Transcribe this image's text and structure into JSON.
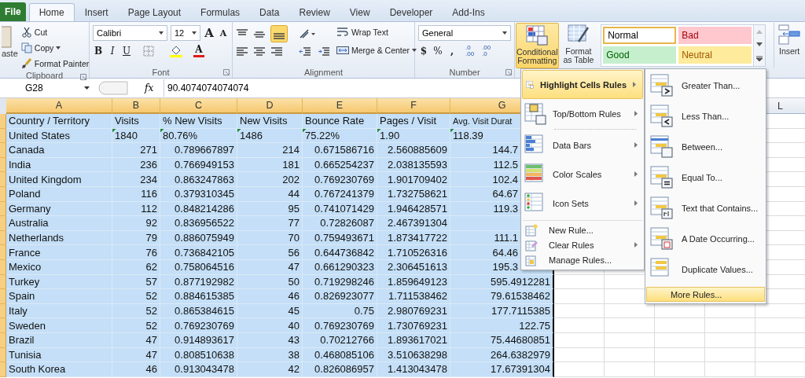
{
  "tabs": [
    {
      "label": "File",
      "kind": "file",
      "selected": false
    },
    {
      "label": "Home",
      "kind": "tab",
      "selected": true
    },
    {
      "label": "Insert",
      "kind": "tab",
      "selected": false
    },
    {
      "label": "Page Layout",
      "kind": "tab",
      "selected": false
    },
    {
      "label": "Formulas",
      "kind": "tab",
      "selected": false
    },
    {
      "label": "Data",
      "kind": "tab",
      "selected": false
    },
    {
      "label": "Review",
      "kind": "tab",
      "selected": false
    },
    {
      "label": "View",
      "kind": "tab",
      "selected": false
    },
    {
      "label": "Developer",
      "kind": "tab",
      "selected": false
    },
    {
      "label": "Add-Ins",
      "kind": "tab",
      "selected": false
    }
  ],
  "ribbon": {
    "clipboard": {
      "paste": "aste",
      "cut": "Cut",
      "copy": "Copy",
      "format_painter": "Format Painter",
      "label": "Clipboard"
    },
    "font": {
      "name": "Calibri",
      "size": "12",
      "grow": "A",
      "shrink": "A",
      "bold": "B",
      "italic": "I",
      "underline": "U",
      "font_color": "A",
      "label": "Font"
    },
    "alignment": {
      "wrap_text": "Wrap Text",
      "merge_center": "Merge & Center",
      "label": "Alignment"
    },
    "number": {
      "format": "General",
      "currency": "$",
      "percent": "%",
      "comma": ",",
      "increase_decimal": [
        ".0",
        ".00"
      ],
      "decrease_decimal": [
        ".00",
        ".0"
      ],
      "label": "Number"
    },
    "conditional_formatting": {
      "line1": "Conditional",
      "line2": "Formatting",
      "selected": true
    },
    "format_as_table": {
      "line1": "Format",
      "line2": "as Table"
    },
    "styles": [
      {
        "label": "Normal",
        "kind": "normal",
        "selected": true
      },
      {
        "label": "Bad",
        "kind": "bad",
        "selected": false
      },
      {
        "label": "Good",
        "kind": "good",
        "selected": false
      },
      {
        "label": "Neutral",
        "kind": "neutral",
        "selected": false
      }
    ],
    "insert": "Insert"
  },
  "formula_bar": {
    "name_box": "G28",
    "fx": "fx",
    "formula": "90.4074074074074"
  },
  "table": {
    "columns": [
      "A",
      "B",
      "C",
      "D",
      "E",
      "F",
      "G",
      "L"
    ],
    "header": [
      "Country / Territory",
      "Visits",
      "% New Visits",
      "New Visits",
      "Bounce Rate",
      "Pages / Visit",
      "Avg. Visit Durat"
    ],
    "rows": [
      {
        "flagged": true,
        "cells": [
          "United States",
          "1840",
          "80.76%",
          "1486",
          "75.22%",
          "1.90",
          "118.39"
        ]
      },
      {
        "flagged": false,
        "cells": [
          "Canada",
          "271",
          "0.789667897",
          "214",
          "0.671586716",
          "2.560885609",
          "144.7"
        ]
      },
      {
        "flagged": false,
        "cells": [
          "India",
          "236",
          "0.766949153",
          "181",
          "0.665254237",
          "2.038135593",
          "112.5"
        ]
      },
      {
        "flagged": false,
        "cells": [
          "United Kingdom",
          "234",
          "0.863247863",
          "202",
          "0.769230769",
          "1.901709402",
          "102.4"
        ]
      },
      {
        "flagged": false,
        "cells": [
          "Poland",
          "116",
          "0.379310345",
          "44",
          "0.767241379",
          "1.732758621",
          "64.67"
        ]
      },
      {
        "flagged": false,
        "cells": [
          "Germany",
          "112",
          "0.848214286",
          "95",
          "0.741071429",
          "1.946428571",
          "119.3"
        ]
      },
      {
        "flagged": false,
        "cells": [
          "Australia",
          "92",
          "0.836956522",
          "77",
          "0.72826087",
          "2.467391304"
        ]
      },
      {
        "flagged": false,
        "cells": [
          "Netherlands",
          "79",
          "0.886075949",
          "70",
          "0.759493671",
          "1.873417722",
          "111.1"
        ]
      },
      {
        "flagged": false,
        "cells": [
          "France",
          "76",
          "0.736842105",
          "56",
          "0.644736842",
          "1.710526316",
          "64.46"
        ]
      },
      {
        "flagged": false,
        "cells": [
          "Mexico",
          "62",
          "0.758064516",
          "47",
          "0.661290323",
          "2.306451613",
          "195.3"
        ]
      },
      {
        "flagged": false,
        "cells": [
          "Turkey",
          "57",
          "0.877192982",
          "50",
          "0.719298246",
          "1.859649123",
          "595.4912281"
        ]
      },
      {
        "flagged": false,
        "cells": [
          "Spain",
          "52",
          "0.884615385",
          "46",
          "0.826923077",
          "1.711538462",
          "79.61538462"
        ]
      },
      {
        "flagged": false,
        "cells": [
          "Italy",
          "52",
          "0.865384615",
          "45",
          "0.75",
          "2.980769231",
          "177.7115385"
        ]
      },
      {
        "flagged": false,
        "cells": [
          "Sweden",
          "52",
          "0.769230769",
          "40",
          "0.769230769",
          "1.730769231",
          "122.75"
        ]
      },
      {
        "flagged": false,
        "cells": [
          "Brazil",
          "47",
          "0.914893617",
          "43",
          "0.70212766",
          "1.893617021",
          "75.44680851"
        ]
      },
      {
        "flagged": false,
        "cells": [
          "Tunisia",
          "47",
          "0.808510638",
          "38",
          "0.468085106",
          "3.510638298",
          "264.6382979"
        ]
      },
      {
        "flagged": false,
        "cells": [
          "South Korea",
          "46",
          "0.913043478",
          "42",
          "0.826086957",
          "1.413043478",
          "17.67391304"
        ]
      }
    ]
  },
  "menu": {
    "items": [
      {
        "label": "Highlight Cells Rules",
        "kind": "large",
        "submenu": true,
        "selected": true
      },
      {
        "label": "Top/Bottom Rules",
        "kind": "large",
        "submenu": true,
        "selected": false
      },
      {
        "label": "Data Bars",
        "kind": "large",
        "submenu": true,
        "selected": false
      },
      {
        "label": "Color Scales",
        "kind": "large",
        "submenu": true,
        "selected": false
      },
      {
        "label": "Icon Sets",
        "kind": "large",
        "submenu": true,
        "selected": false
      },
      {
        "label": "New Rule...",
        "kind": "small",
        "submenu": false,
        "selected": false
      },
      {
        "label": "Clear Rules",
        "kind": "small",
        "submenu": true,
        "selected": false
      },
      {
        "label": "Manage Rules...",
        "kind": "small",
        "submenu": false,
        "selected": false
      }
    ]
  },
  "submenu": {
    "items": [
      {
        "label": "Greater Than...",
        "kind": "large",
        "selected": false
      },
      {
        "label": "Less Than...",
        "kind": "large",
        "selected": false
      },
      {
        "label": "Between...",
        "kind": "large",
        "selected": false
      },
      {
        "label": "Equal To...",
        "kind": "large",
        "selected": false
      },
      {
        "label": "Text that Contains...",
        "kind": "large",
        "selected": false
      },
      {
        "label": "A Date Occurring...",
        "kind": "large",
        "selected": false
      },
      {
        "label": "Duplicate Values...",
        "kind": "large",
        "selected": false
      },
      {
        "label": "More Rules...",
        "kind": "footer",
        "selected": true
      }
    ]
  }
}
